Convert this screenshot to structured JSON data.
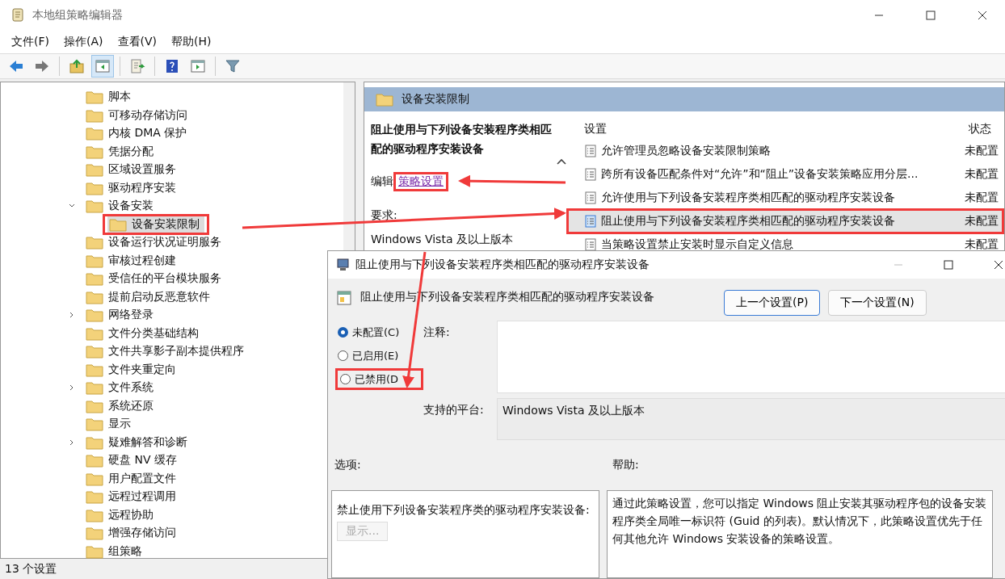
{
  "window": {
    "title": "本地组策略编辑器"
  },
  "menu": [
    "文件(F)",
    "操作(A)",
    "查看(V)",
    "帮助(H)"
  ],
  "toolbar": [
    {
      "kind": "back",
      "pressed": false
    },
    {
      "kind": "forward",
      "pressed": false
    },
    {
      "kind": "up",
      "pressed": false
    },
    {
      "kind": "tree",
      "pressed": true
    },
    {
      "kind": "export",
      "pressed": false
    },
    {
      "kind": "help",
      "pressed": false
    },
    {
      "kind": "pane",
      "pressed": false
    },
    {
      "kind": "filter",
      "pressed": false
    }
  ],
  "tree": [
    {
      "label": "脚本"
    },
    {
      "label": "可移动存储访问"
    },
    {
      "label": "内核 DMA 保护"
    },
    {
      "label": "凭据分配"
    },
    {
      "label": "区域设置服务"
    },
    {
      "label": "驱动程序安装"
    },
    {
      "label": "设备安装",
      "expanded": true,
      "children": [
        {
          "label": "设备安装限制",
          "selected": true,
          "highlighted": true
        }
      ]
    },
    {
      "label": "设备运行状况证明服务"
    },
    {
      "label": "审核过程创建"
    },
    {
      "label": "受信任的平台模块服务"
    },
    {
      "label": "提前启动反恶意软件"
    },
    {
      "label": "网络登录",
      "expanded": false
    },
    {
      "label": "文件分类基础结构"
    },
    {
      "label": "文件共享影子副本提供程序"
    },
    {
      "label": "文件夹重定向"
    },
    {
      "label": "文件系统",
      "expanded": false
    },
    {
      "label": "系统还原"
    },
    {
      "label": "显示"
    },
    {
      "label": "疑难解答和诊断",
      "expanded": false
    },
    {
      "label": "硬盘 NV 缓存"
    },
    {
      "label": "用户配置文件"
    },
    {
      "label": "远程过程调用"
    },
    {
      "label": "远程协助"
    },
    {
      "label": "增强存储访问"
    },
    {
      "label": "组策略"
    }
  ],
  "details": {
    "header": "设备安装限制",
    "policy_title": "阻止使用与下列设备安装程序类相匹配的驱动程序安装设备",
    "edit_prefix": "编辑",
    "edit_link": "策略设置",
    "edit_link_highlighted": true,
    "requirements_label": "要求:",
    "requirements": "Windows Vista 及以上版本"
  },
  "settings_list": {
    "columns": [
      "设置",
      "状态"
    ],
    "rows": [
      {
        "name": "允许管理员忽略设备安装限制策略",
        "state": "未配置",
        "selected": false
      },
      {
        "name": "跨所有设备匹配条件对“允许”和“阻止”设备安装策略应用分层...",
        "state": "未配置",
        "selected": false
      },
      {
        "name": "允许使用与下列设备安装程序类相匹配的驱动程序安装设备",
        "state": "未配置",
        "selected": false
      },
      {
        "name": "阻止使用与下列设备安装程序类相匹配的驱动程序安装设备",
        "state": "未配置",
        "selected": true,
        "highlighted": true
      },
      {
        "name": "当策略设置禁止安装时显示自定义信息",
        "state": "未配置",
        "selected": false
      }
    ]
  },
  "status_bar": "13 个设置",
  "dialog": {
    "title": "阻止使用与下列设备安装程序类相匹配的驱动程序安装设备",
    "policy_name": "阻止使用与下列设备安装程序类相匹配的驱动程序安装设备",
    "buttons": [
      {
        "label": "上一个设置(P)",
        "focused": true
      },
      {
        "label": "下一个设置(N)",
        "focused": false
      }
    ],
    "options": [
      {
        "label": "未配置(C)",
        "selected": true
      },
      {
        "label": "已启用(E)",
        "selected": false
      },
      {
        "label": "已禁用(D",
        "selected": false,
        "highlighted": true
      }
    ],
    "comment_label": "注释:",
    "platform_label": "支持的平台:",
    "platform": "Windows Vista 及以上版本",
    "options_label": "选项:",
    "help_label": "帮助:",
    "options_text": "禁止使用下列设备安装程序类的驱动程序安装设备:",
    "show_button": {
      "label": "显示...",
      "disabled": true
    },
    "help_text": "通过此策略设置，您可以指定 Windows 阻止安装其驱动程序包的设备安装程序类全局唯一标识符 (Guid 的列表)。默认情况下，此策略设置优先于任何其他允许 Windows 安装设备的策略设置。"
  }
}
